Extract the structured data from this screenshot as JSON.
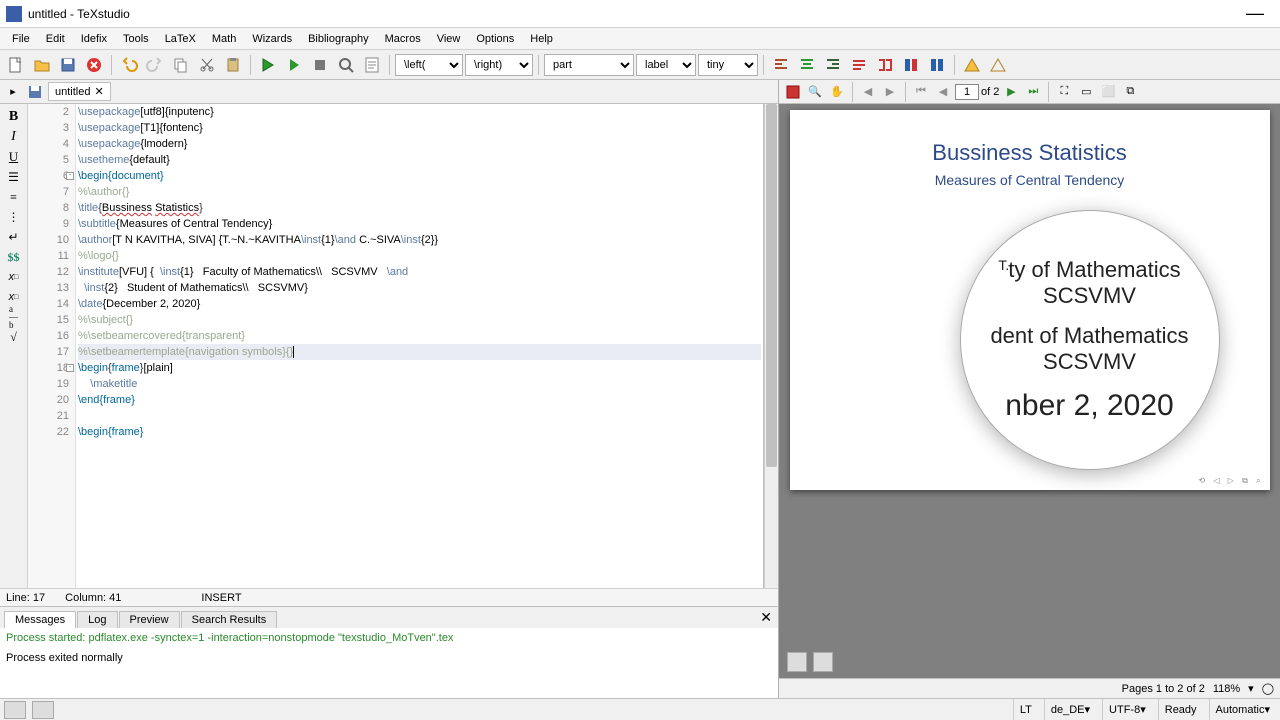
{
  "window": {
    "title": "untitled - TeXstudio"
  },
  "menu": [
    "File",
    "Edit",
    "Idefix",
    "Tools",
    "LaTeX",
    "Math",
    "Wizards",
    "Bibliography",
    "Macros",
    "View",
    "Options",
    "Help"
  ],
  "toolbar": {
    "left_cmd": "\\left(",
    "right_cmd": "\\right)",
    "sel_part": "part",
    "sel_label": "label",
    "sel_tiny": "tiny"
  },
  "tabs": {
    "doc1": "untitled"
  },
  "code": {
    "first_line_no": 2,
    "lines": [
      {
        "t": "cmd",
        "s": "\\usepackage[utf8]{inputenc}"
      },
      {
        "t": "cmd",
        "s": "\\usepackage[T1]{fontenc}"
      },
      {
        "t": "cmd",
        "s": "\\usepackage{lmodern}"
      },
      {
        "t": "cmd",
        "s": "\\usetheme{default}"
      },
      {
        "t": "kw",
        "s": "\\begin{document}"
      },
      {
        "t": "comment",
        "s": "%\\author{}"
      },
      {
        "t": "title",
        "s": "\\title{Bussiness Statistics}"
      },
      {
        "t": "cmd",
        "s": "\\subtitle{Measures of Central Tendency}"
      },
      {
        "t": "cmd",
        "s": "\\author[T N KAVITHA, SIVA] {T.~N.~KAVITHA\\inst{1}\\and C.~SIVA\\inst{2}}"
      },
      {
        "t": "comment",
        "s": "%\\logo{}"
      },
      {
        "t": "cmd",
        "s": "\\institute[VFU] {  \\inst{1}   Faculty of Mathematics\\\\   SCSVMV   \\and"
      },
      {
        "t": "cmd",
        "s": "  \\inst{2}   Student of Mathematics\\\\   SCSVMV}"
      },
      {
        "t": "cmd",
        "s": "\\date{December 2, 2020}"
      },
      {
        "t": "comment",
        "s": "%\\subject{}"
      },
      {
        "t": "comment",
        "s": "%\\setbeamercovered{transparent}"
      },
      {
        "t": "comment",
        "s": "%\\setbeamertemplate{navigation symbols}{}",
        "active": true,
        "cursor": true
      },
      {
        "t": "kw2",
        "s": "\\begin{frame}[plain]"
      },
      {
        "t": "cmd",
        "s": "    \\maketitle"
      },
      {
        "t": "kw",
        "s": "\\end{frame}"
      },
      {
        "t": "blank",
        "s": ""
      },
      {
        "t": "kw",
        "s": "\\begin{frame}"
      }
    ]
  },
  "editor_status": {
    "line": "Line: 17",
    "col": "Column: 41",
    "mode": "INSERT"
  },
  "bottom_tabs": [
    "Messages",
    "Log",
    "Preview",
    "Search Results"
  ],
  "messages": {
    "started": "Process started: pdflatex.exe -synctex=1 -interaction=nonstopmode \"texstudio_MoTven\".tex",
    "exited": "Process exited normally"
  },
  "pdf": {
    "page_input": "1",
    "page_of": "of 2",
    "title": "Bussiness Statistics",
    "subtitle": "Measures of Central Tendency"
  },
  "magnifier": {
    "l1": "ty of Mathematics",
    "l1pre": "T.",
    "l2": "SCSVMV",
    "l3": "dent of Mathematics",
    "l4": "SCSVMV",
    "l5": "nber 2, 2020"
  },
  "preview_status": {
    "pages": "Pages 1 to 2 of 2",
    "zoom": "118%"
  },
  "status": {
    "lt": "LT",
    "lang": "de_DE",
    "enc": "UTF-8",
    "ready": "Ready",
    "auto": "Automatic"
  }
}
